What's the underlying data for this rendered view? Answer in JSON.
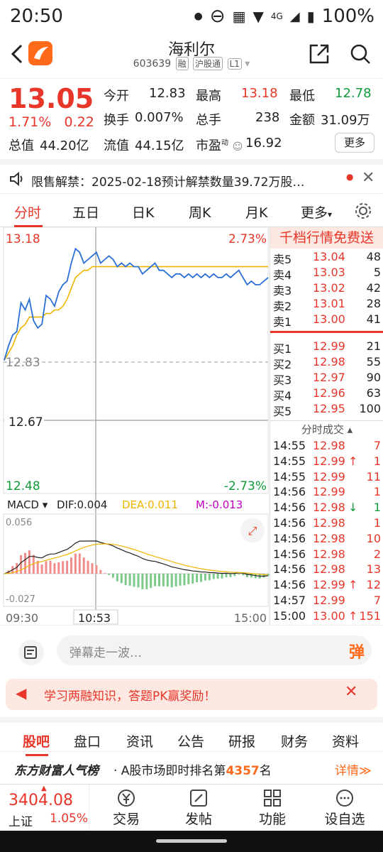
{
  "status": {
    "time": "20:50",
    "battery": "100%",
    "network": "4G"
  },
  "header": {
    "name": "海利尔",
    "code": "603639",
    "tags": [
      "融",
      "沪股通",
      "L1"
    ]
  },
  "quote": {
    "price": "13.05",
    "change_pct": "1.71%",
    "change": "0.22",
    "open_label": "今开",
    "open": "12.83",
    "high_label": "最高",
    "high": "13.18",
    "low_label": "最低",
    "low": "12.78",
    "turnover_label": "换手",
    "turnover": "0.007%",
    "volume_label": "总手",
    "volume": "238",
    "amount_label": "金额",
    "amount": "31.09万",
    "mcap_label": "总值",
    "mcap": "44.20亿",
    "float_label": "流值",
    "float": "44.15亿",
    "pe_label": "市盈",
    "pe_sup": "动",
    "pe": "16.92",
    "more_button": "更多"
  },
  "notice": {
    "text": "限售解禁：2025-02-18预计解禁数量39.72万股…"
  },
  "tabs": [
    "分时",
    "五日",
    "日K",
    "周K",
    "月K",
    "更多"
  ],
  "chart": {
    "top_price": "13.18",
    "top_pct": "2.73%",
    "prev_close": "12.83",
    "cursor_price": "12.67",
    "bottom_price": "12.48",
    "bottom_pct": "-2.73%",
    "macd_label": "MACD",
    "dif": "DIF:0.004",
    "dea": "DEA:0.011",
    "m": "M:-0.013",
    "macd_top": "0.056",
    "macd_bottom": "-0.027",
    "time_start": "09:30",
    "time_cursor": "10:53",
    "time_end": "15:00"
  },
  "chart_data": {
    "type": "line",
    "ylim": [
      12.48,
      13.18
    ],
    "prev_close": 12.83,
    "price": [
      12.83,
      12.87,
      12.9,
      12.91,
      12.99,
      12.97,
      13.0,
      12.94,
      12.92,
      12.93,
      13.01,
      13.0,
      12.98,
      13.02,
      13.04,
      13.05,
      13.1,
      13.14,
      13.13,
      13.1,
      13.11,
      13.12,
      13.13,
      13.1,
      13.11,
      13.12,
      13.11,
      13.09,
      13.1,
      13.09,
      13.1,
      13.09,
      13.09,
      13.07,
      13.08,
      13.09,
      13.1,
      13.08,
      13.08,
      13.07,
      13.06,
      13.07,
      13.07,
      13.06,
      13.07,
      13.06,
      13.07,
      13.06,
      13.07,
      13.06,
      13.07,
      13.06,
      13.06,
      13.07,
      13.06,
      13.07,
      13.08,
      13.06,
      13.04,
      13.05,
      13.04,
      13.04,
      13.05,
      13.06
    ],
    "avg": [
      12.83,
      12.85,
      12.87,
      12.9,
      12.92,
      12.93,
      12.95,
      12.95,
      12.95,
      12.95,
      12.96,
      12.96,
      12.97,
      12.97,
      12.98,
      13.0,
      13.03,
      13.06,
      13.07,
      13.08,
      13.08,
      13.09,
      13.09,
      13.09,
      13.09,
      13.09,
      13.09,
      13.09,
      13.09,
      13.09,
      13.09,
      13.09,
      13.09,
      13.09,
      13.09,
      13.09,
      13.09,
      13.09,
      13.09,
      13.09,
      13.09,
      13.09,
      13.09,
      13.09,
      13.09,
      13.09,
      13.09,
      13.09,
      13.09,
      13.09,
      13.09,
      13.09,
      13.09,
      13.09,
      13.09,
      13.09,
      13.09,
      13.09,
      13.09,
      13.09,
      13.09,
      13.09,
      13.09,
      13.09
    ]
  },
  "orderbook": {
    "header": "千档行情免费送",
    "asks": [
      [
        "卖5",
        "13.04",
        "48"
      ],
      [
        "卖4",
        "13.03",
        "5"
      ],
      [
        "卖3",
        "13.02",
        "42"
      ],
      [
        "卖2",
        "13.01",
        "28"
      ],
      [
        "卖1",
        "13.00",
        "41"
      ]
    ],
    "bids": [
      [
        "买1",
        "12.99",
        "21"
      ],
      [
        "买2",
        "12.98",
        "55"
      ],
      [
        "买3",
        "12.97",
        "90"
      ],
      [
        "买4",
        "12.96",
        "63"
      ],
      [
        "买5",
        "12.95",
        "100"
      ]
    ],
    "ticks_title": "分时成交",
    "ticks": [
      [
        "14:55",
        "12.98",
        "",
        "7"
      ],
      [
        "14:55",
        "12.99",
        "↑",
        "1"
      ],
      [
        "14:55",
        "12.99",
        "",
        "11"
      ],
      [
        "14:56",
        "12.99",
        "",
        "1"
      ],
      [
        "14:56",
        "12.98",
        "↓",
        "1"
      ],
      [
        "14:56",
        "12.98",
        "",
        "1"
      ],
      [
        "14:56",
        "12.98",
        "",
        "10"
      ],
      [
        "14:56",
        "12.98",
        "",
        "2"
      ],
      [
        "14:56",
        "12.98",
        "",
        "13"
      ],
      [
        "14:56",
        "12.99",
        "↑",
        "12"
      ],
      [
        "14:57",
        "12.99",
        "",
        "7"
      ],
      [
        "15:00",
        "13.00",
        "↑",
        "151"
      ]
    ]
  },
  "danmu": {
    "placeholder": "弹幕走一波…",
    "button": "弹"
  },
  "ad": {
    "text": "学习两融知识，答题PK赢奖励！"
  },
  "subtabs": [
    "股吧",
    "盘口",
    "资讯",
    "公告",
    "研报",
    "财务",
    "资料"
  ],
  "rank": {
    "brand": "东方财富人气榜",
    "text_pre": "· A股市场即时排名第",
    "rank": "4357",
    "text_post": "名",
    "detail": "详情≫"
  },
  "index": {
    "value": "3404.08",
    "name": "上证",
    "pct": "1.05%"
  },
  "bottom_nav": [
    "交易",
    "发帖",
    "功能",
    "设自选"
  ],
  "colors": {
    "up": "#e8362a",
    "down": "#109a3a",
    "price_line": "#2a6fd6",
    "avg_line": "#f0b400"
  }
}
